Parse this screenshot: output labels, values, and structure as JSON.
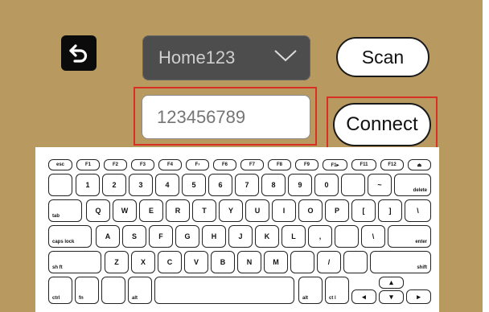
{
  "network": {
    "selected_ssid": "Home123",
    "password_placeholder": "123456789"
  },
  "buttons": {
    "scan": "Scan",
    "connect": "Connect"
  },
  "icons": {
    "back": "back-arrow-icon",
    "dropdown": "chevron-down-icon"
  },
  "colors": {
    "background": "#b8995f",
    "dropdown_bg": "#4d4d4d",
    "highlight": "#d93025"
  },
  "keyboard": {
    "row0": [
      "esc",
      "F1",
      "F2",
      "F3",
      "F4",
      "F›",
      "F6",
      "F7",
      "F8",
      "F9",
      "F1▸",
      "F11",
      "F12",
      "⏏"
    ],
    "row1": [
      "",
      "1",
      "2",
      "3",
      "4",
      "5",
      "6",
      "7",
      "8",
      "9",
      "0",
      "",
      "~",
      "delete"
    ],
    "row2": [
      "tab",
      "Q",
      "W",
      "E",
      "R",
      "T",
      "Y",
      "U",
      "I",
      "O",
      "P",
      "[",
      "]",
      "\\"
    ],
    "row3": [
      "caps lock",
      "A",
      "S",
      "F",
      "G",
      "H",
      "J",
      "K",
      "L",
      ",",
      "",
      "\\",
      "enter"
    ],
    "row4": [
      "sh ft",
      "Z",
      "X",
      "C",
      "V",
      "B",
      "N",
      "M",
      "",
      "/",
      "",
      "shift"
    ],
    "row5": [
      "ctrl",
      "fn",
      "",
      "alt",
      "",
      "alt",
      "ct l",
      "◂",
      "▴",
      "▾",
      "▸"
    ]
  }
}
